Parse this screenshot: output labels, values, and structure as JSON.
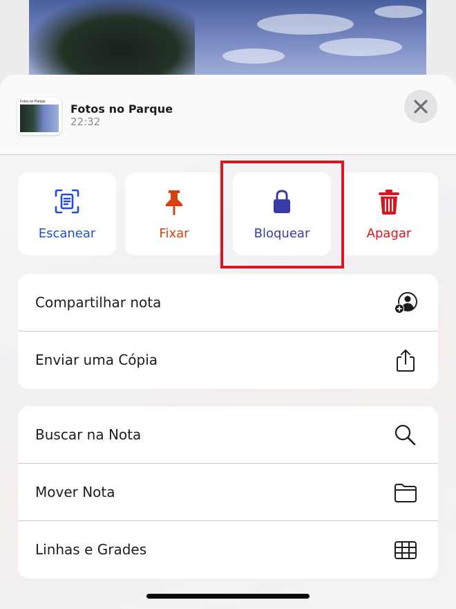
{
  "note": {
    "thumbnail_caption": "Fotos no Parque",
    "title": "Fotos no Parque",
    "time": "22:32"
  },
  "actions": [
    {
      "label": "Escanear",
      "icon": "scan-document-icon",
      "color": "#1a4fd6"
    },
    {
      "label": "Fixar",
      "icon": "pin-icon",
      "color": "#d6410f"
    },
    {
      "label": "Bloquear",
      "icon": "lock-icon",
      "color": "#3a3aa8"
    },
    {
      "label": "Apagar",
      "icon": "trash-icon",
      "color": "#d9151f"
    }
  ],
  "highlight_color": "#e0141c",
  "list_groups": [
    {
      "items": [
        {
          "label": "Compartilhar nota",
          "icon": "add-person-icon"
        },
        {
          "label": "Enviar uma Cópia",
          "icon": "share-icon"
        }
      ]
    },
    {
      "items": [
        {
          "label": "Buscar na Nota",
          "icon": "search-icon"
        },
        {
          "label": "Mover Nota",
          "icon": "folder-icon"
        },
        {
          "label": "Linhas e Grades",
          "icon": "grid-icon"
        }
      ]
    }
  ]
}
